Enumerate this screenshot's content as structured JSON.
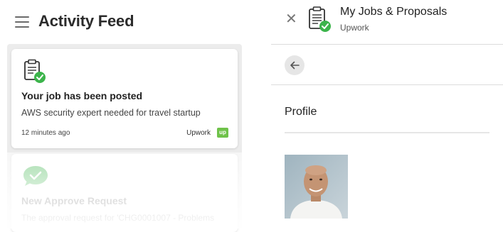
{
  "left_panel": {
    "title": "Activity Feed",
    "cards": [
      {
        "icon": "clipboard-check-icon",
        "title": "Your job has been posted",
        "description": "AWS security expert needed for travel startup",
        "time": "12 minutes ago",
        "source": "Upwork",
        "badge": "up"
      },
      {
        "icon": "chat-check-icon",
        "title": "New Approve Request",
        "description": "The approval request for 'CHG0001007 - Problems"
      }
    ]
  },
  "right_panel": {
    "title": "My Jobs & Proposals",
    "subtitle": "Upwork",
    "section_title": "Profile"
  },
  "colors": {
    "accent_green": "#3cb44b",
    "upwork_green": "#6fc24a"
  }
}
